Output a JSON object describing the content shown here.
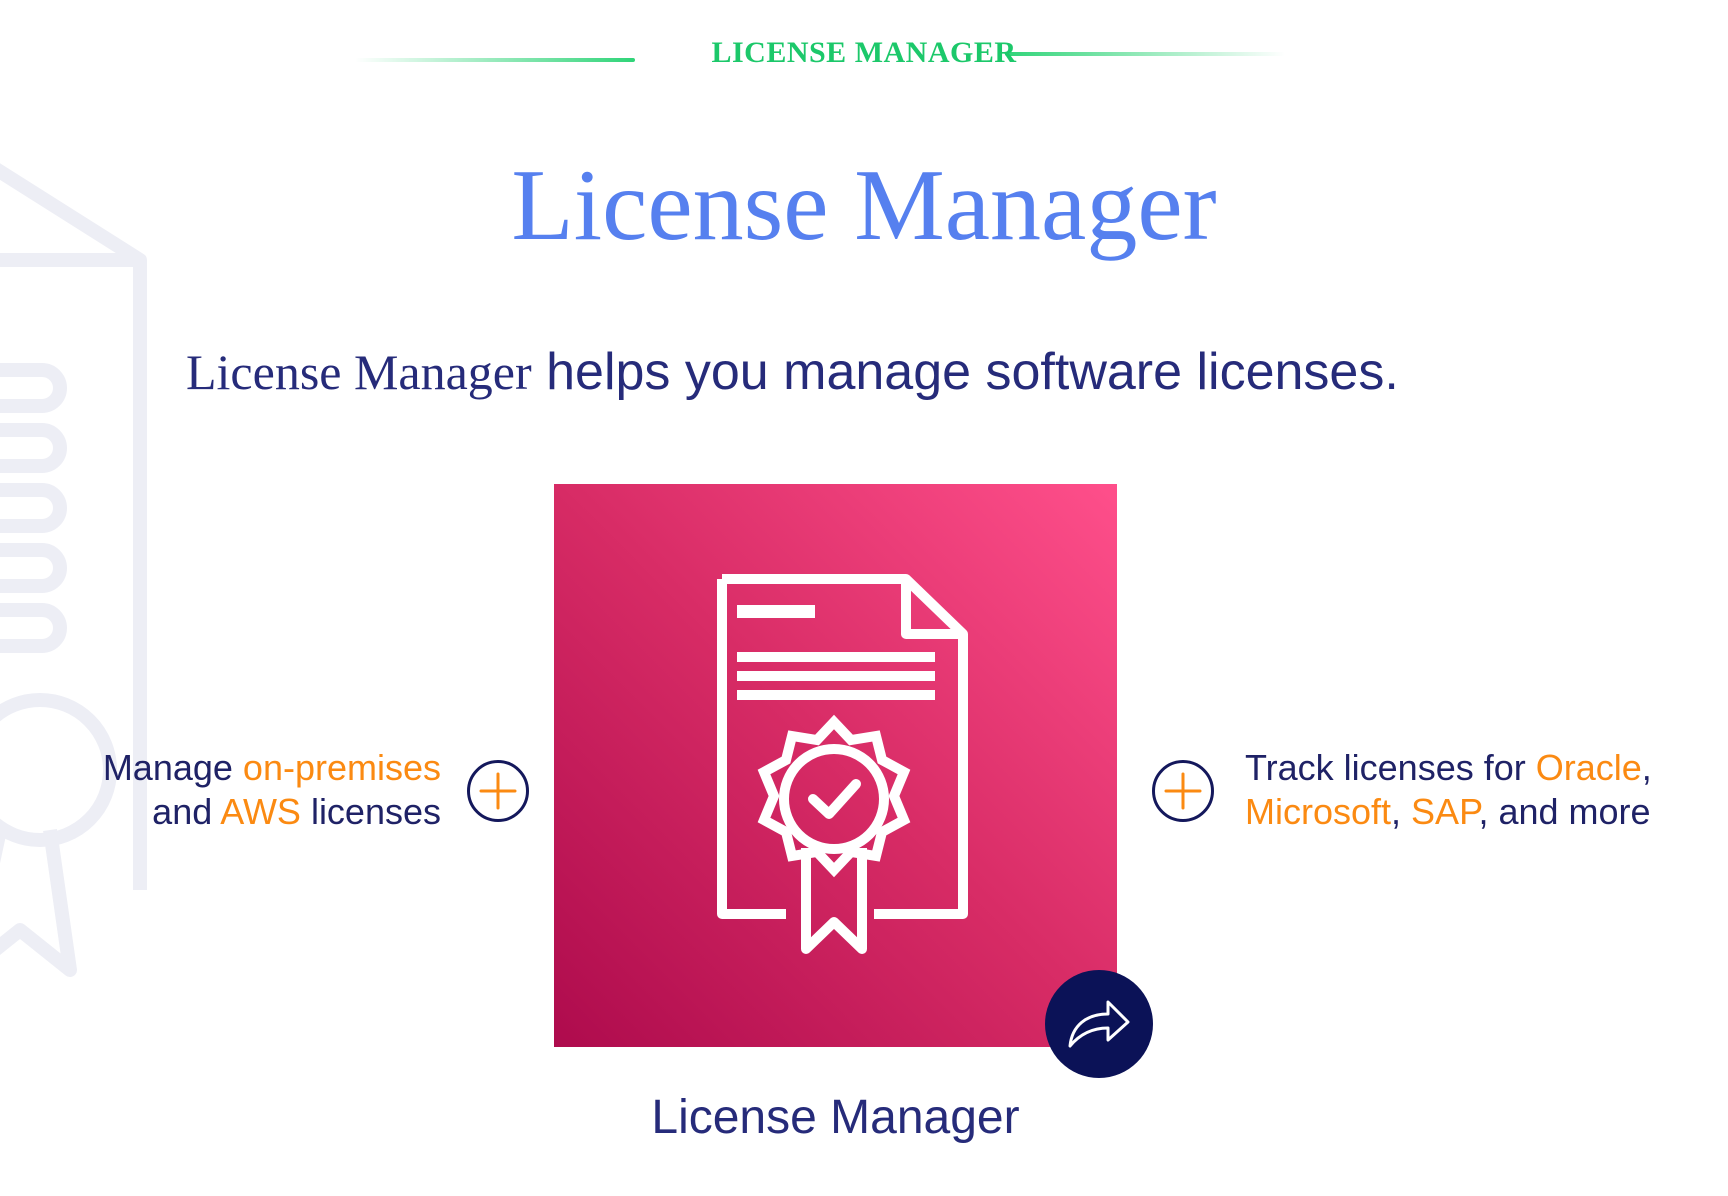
{
  "header": {
    "eyebrow": "LICENSE MANAGER",
    "title": "License Manager"
  },
  "subtitle": {
    "serif_part": "License Manager",
    "rest": " helps you manage software licenses."
  },
  "left_feature": {
    "w1": "Manage ",
    "h1": "on-premises",
    "w2": "and ",
    "h2": "AWS",
    "w3": " licenses"
  },
  "right_feature": {
    "w1": "Track licenses for ",
    "h1": "Oracle",
    "w2": ",",
    "h2": "Microsoft",
    "w3": ", ",
    "h3": "SAP",
    "w4": ", and more"
  },
  "service": {
    "label": "License Manager",
    "icon": "license-certificate-icon",
    "share_icon": "share-arrow-icon"
  },
  "colors": {
    "eyebrow": "#1cc86a",
    "title": "#5680ef",
    "text": "#262b7a",
    "highlight": "#fb8a12",
    "tile_dark": "#ae0b4d",
    "tile_light": "#ff4f8b",
    "share_button": "#0b1257"
  }
}
